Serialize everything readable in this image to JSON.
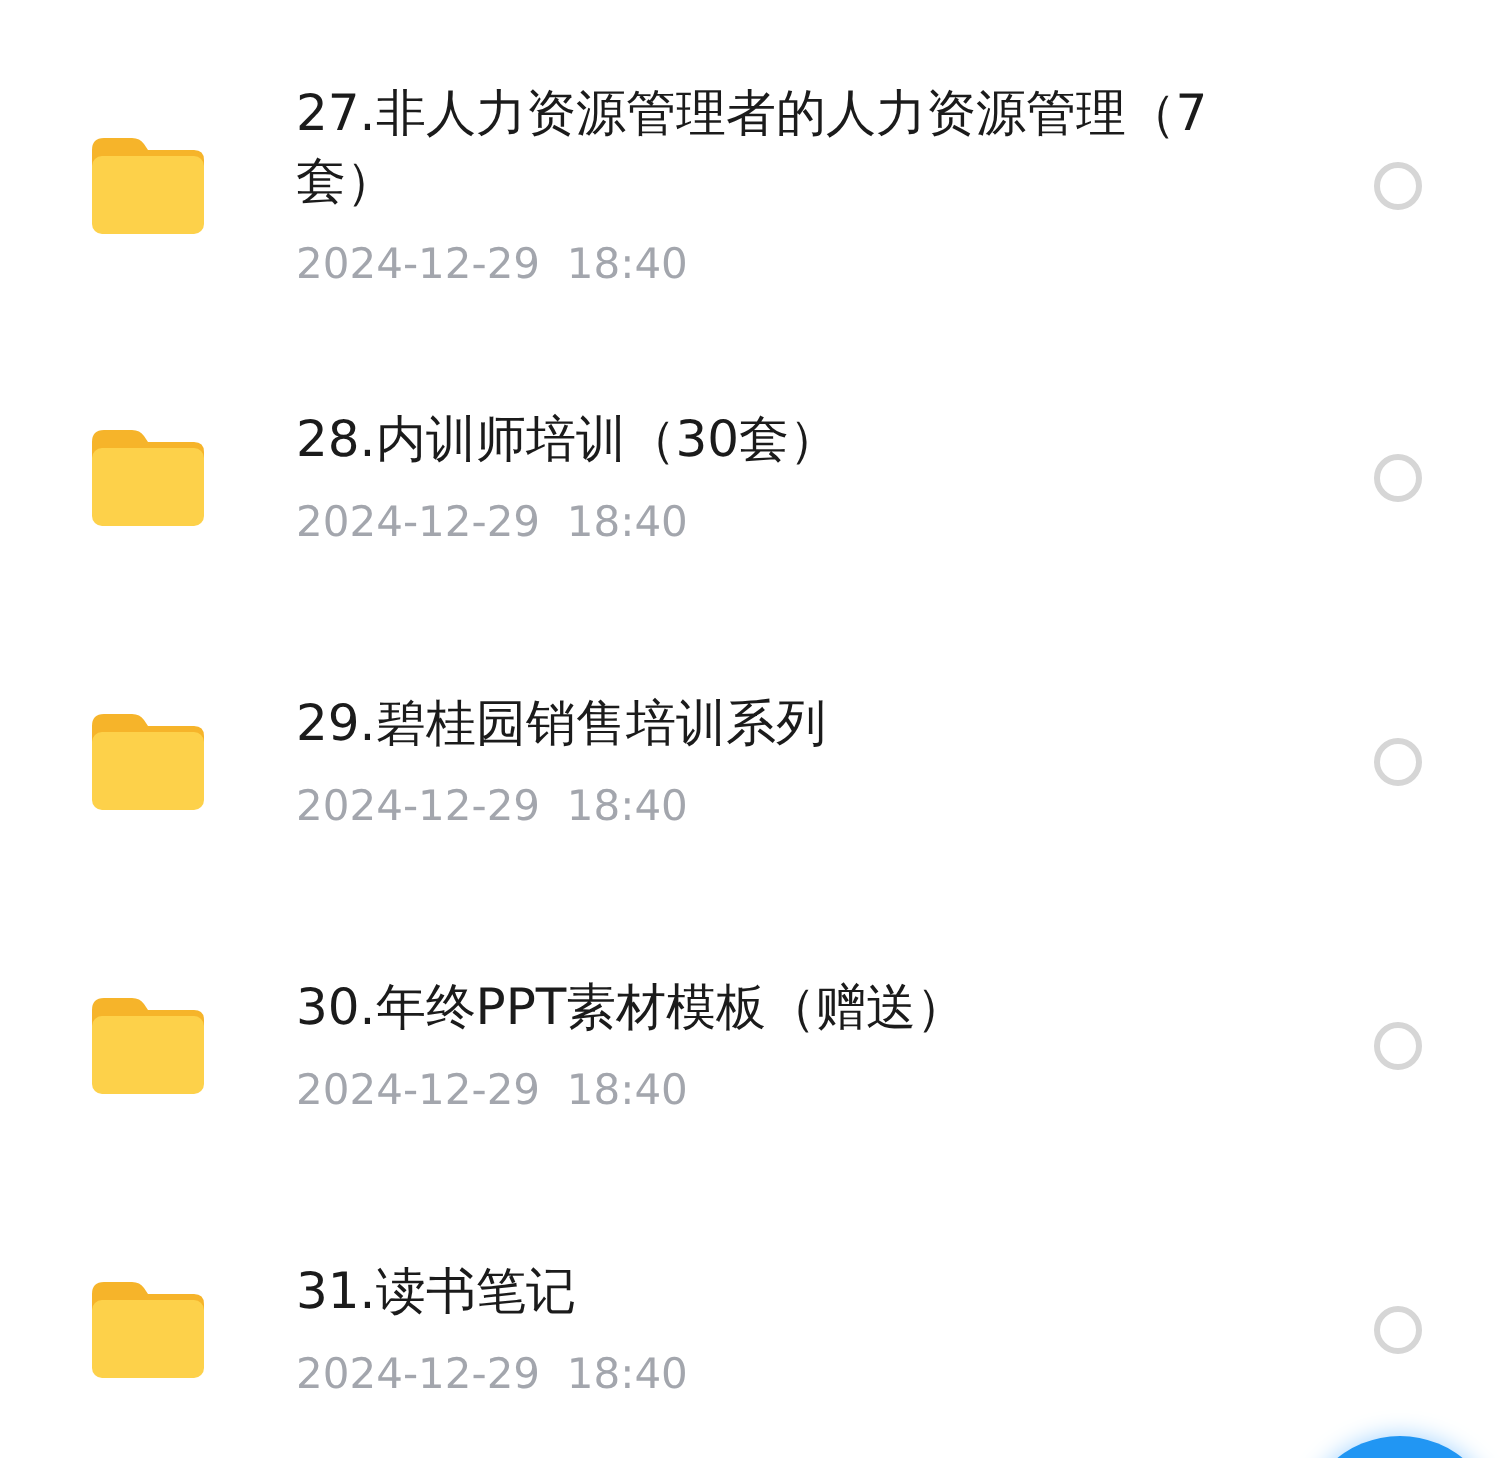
{
  "files": [
    {
      "name": "27.非人力资源管理者的人力资源管理（7套）",
      "date": "2024-12-29  18:40",
      "selected": false
    },
    {
      "name": "28.内训师培训（30套）",
      "date": "2024-12-29  18:40",
      "selected": false
    },
    {
      "name": "29.碧桂园销售培训系列",
      "date": "2024-12-29  18:40",
      "selected": false
    },
    {
      "name": "30.年终PPT素材模板（赠送）",
      "date": "2024-12-29  18:40",
      "selected": false
    },
    {
      "name": "31.读书笔记",
      "date": "2024-12-29  18:40",
      "selected": false
    }
  ]
}
